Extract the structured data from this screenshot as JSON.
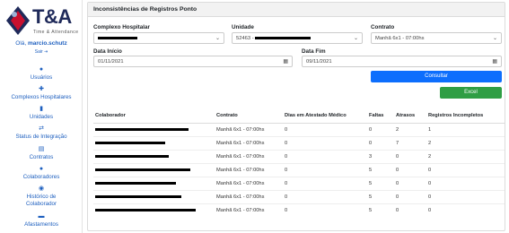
{
  "brand": {
    "name": "T&A",
    "subtitle": "Time & Attendance"
  },
  "user": {
    "greeting": "Olá, ",
    "username": "marcio.schutz",
    "logout": "Sair"
  },
  "nav": [
    {
      "label": "Usuários",
      "icon": "users-icon"
    },
    {
      "label": "Complexos Hospitalares",
      "icon": "hospital-icon"
    },
    {
      "label": "Unidades",
      "icon": "building-icon"
    },
    {
      "label": "Status de Integração",
      "icon": "sync-icon"
    },
    {
      "label": "Contratos",
      "icon": "document-icon"
    },
    {
      "label": "Colaboradores",
      "icon": "people-icon"
    },
    {
      "label": "Histórico de Colaborador",
      "icon": "history-icon"
    },
    {
      "label": "Afastamentos",
      "icon": "car-icon"
    }
  ],
  "page": {
    "title": "Inconsistências de Registros Ponto"
  },
  "filters": {
    "complexo": {
      "label": "Complexo Hospitalar",
      "value": ""
    },
    "unidade": {
      "label": "Unidade",
      "value": "52463 -"
    },
    "contrato": {
      "label": "Contrato",
      "value": "Manhã 6x1 - 07:00hs"
    },
    "data_inicio": {
      "label": "Data Início",
      "value": "01/11/2021"
    },
    "data_fim": {
      "label": "Data Fim",
      "value": "09/11/2021"
    }
  },
  "buttons": {
    "consultar": "Consultar",
    "excel": "Excel"
  },
  "colors": {
    "primary": "#0d6efd",
    "success": "#2f9e44",
    "link": "#1d5fbf"
  },
  "table": {
    "headers": [
      "Colaborador",
      "Contrato",
      "Dias em Atestado Médico",
      "Faltas",
      "Atrasos",
      "Registros Incompletos"
    ],
    "rows": [
      {
        "contrato": "Manhã 6x1 - 07:00hs",
        "atestado": "0",
        "faltas": "0",
        "atrasos": "2",
        "incompletos": "1"
      },
      {
        "contrato": "Manhã 6x1 - 07:00hs",
        "atestado": "0",
        "faltas": "0",
        "atrasos": "7",
        "incompletos": "2"
      },
      {
        "contrato": "Manhã 6x1 - 07:00hs",
        "atestado": "0",
        "faltas": "3",
        "atrasos": "0",
        "incompletos": "2"
      },
      {
        "contrato": "Manhã 6x1 - 07:00hs",
        "atestado": "0",
        "faltas": "5",
        "atrasos": "0",
        "incompletos": "0"
      },
      {
        "contrato": "Manhã 6x1 - 07:00hs",
        "atestado": "0",
        "faltas": "5",
        "atrasos": "0",
        "incompletos": "0"
      },
      {
        "contrato": "Manhã 6x1 - 07:00hs",
        "atestado": "0",
        "faltas": "5",
        "atrasos": "0",
        "incompletos": "0"
      },
      {
        "contrato": "Manhã 6x1 - 07:00hs",
        "atestado": "0",
        "faltas": "5",
        "atrasos": "0",
        "incompletos": "0"
      }
    ]
  }
}
